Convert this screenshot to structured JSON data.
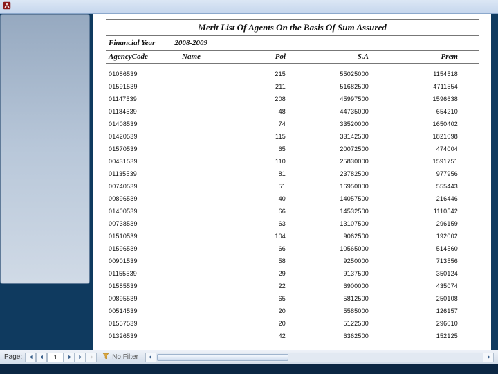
{
  "titlebar": {
    "app_icon": "access-icon"
  },
  "report": {
    "title": "Merit List Of Agents On the Basis Of Sum Assured",
    "financial_year_label": "Financial Year",
    "financial_year_value": "2008-2009",
    "columns": {
      "code": "AgencyCode",
      "name": "Name",
      "pol": "Pol",
      "sa": "S.A",
      "prem": "Prem"
    },
    "rows": [
      {
        "code": "01086539",
        "name": "",
        "pol": "215",
        "sa": "55025000",
        "prem": "1154518"
      },
      {
        "code": "01591539",
        "name": "",
        "pol": "211",
        "sa": "51682500",
        "prem": "4711554"
      },
      {
        "code": "01147539",
        "name": "",
        "pol": "208",
        "sa": "45997500",
        "prem": "1596638"
      },
      {
        "code": "01184539",
        "name": "",
        "pol": "48",
        "sa": "44735000",
        "prem": "654210"
      },
      {
        "code": "01408539",
        "name": "",
        "pol": "74",
        "sa": "33520000",
        "prem": "1650402"
      },
      {
        "code": "01420539",
        "name": "",
        "pol": "115",
        "sa": "33142500",
        "prem": "1821098"
      },
      {
        "code": "01570539",
        "name": "",
        "pol": "65",
        "sa": "20072500",
        "prem": "474004"
      },
      {
        "code": "00431539",
        "name": "",
        "pol": "110",
        "sa": "25830000",
        "prem": "1591751"
      },
      {
        "code": "01135539",
        "name": "",
        "pol": "81",
        "sa": "23782500",
        "prem": "977956"
      },
      {
        "code": "00740539",
        "name": "",
        "pol": "51",
        "sa": "16950000",
        "prem": "555443"
      },
      {
        "code": "00896539",
        "name": "",
        "pol": "40",
        "sa": "14057500",
        "prem": "216446"
      },
      {
        "code": "01400539",
        "name": "",
        "pol": "66",
        "sa": "14532500",
        "prem": "1110542"
      },
      {
        "code": "00738539",
        "name": "",
        "pol": "63",
        "sa": "13107500",
        "prem": "296159"
      },
      {
        "code": "01510539",
        "name": "",
        "pol": "104",
        "sa": "9062500",
        "prem": "192002"
      },
      {
        "code": "01596539",
        "name": "",
        "pol": "66",
        "sa": "10565000",
        "prem": "514560"
      },
      {
        "code": "00901539",
        "name": "",
        "pol": "58",
        "sa": "9250000",
        "prem": "713556"
      },
      {
        "code": "01155539",
        "name": "",
        "pol": "29",
        "sa": "9137500",
        "prem": "350124"
      },
      {
        "code": "01585539",
        "name": "",
        "pol": "22",
        "sa": "6900000",
        "prem": "435074"
      },
      {
        "code": "00895539",
        "name": "",
        "pol": "65",
        "sa": "5812500",
        "prem": "250108"
      },
      {
        "code": "00514539",
        "name": "",
        "pol": "20",
        "sa": "5585000",
        "prem": "126157"
      },
      {
        "code": "01557539",
        "name": "",
        "pol": "20",
        "sa": "5122500",
        "prem": "296010"
      },
      {
        "code": "01326539",
        "name": "",
        "pol": "42",
        "sa": "6362500",
        "prem": "152125"
      }
    ]
  },
  "statusbar": {
    "page_label": "Page:",
    "page_value": "1",
    "no_filter_label": "No Filter"
  }
}
